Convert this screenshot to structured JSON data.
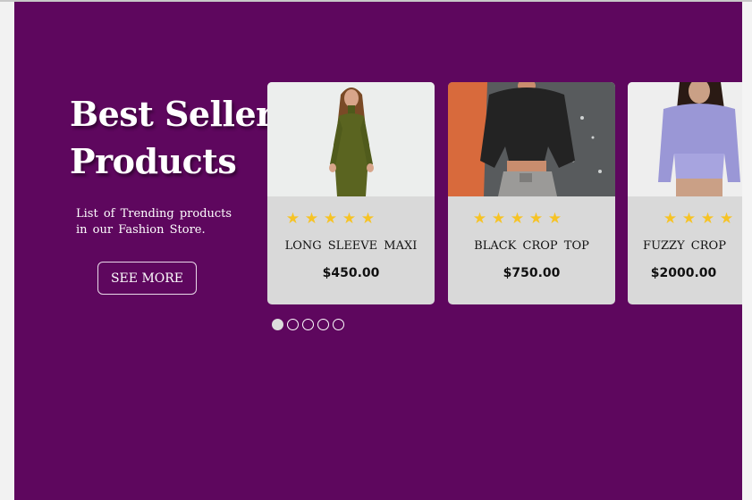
{
  "section": {
    "title_line1": "Best Seller",
    "title_line2": "Products",
    "subtitle_line1": "List of Trending products",
    "subtitle_line2": "in our Fashion Store.",
    "see_more_label": "SEE MORE"
  },
  "products": [
    {
      "name": "LONG SLEEVE MAXI",
      "price": "$450.00",
      "rating": 5,
      "star": "★"
    },
    {
      "name": "BLACK CROP TOP",
      "price": "$750.00",
      "rating": 5,
      "star": "★"
    },
    {
      "name": "FUZZY CROP",
      "price": "$2000.00",
      "rating": 4,
      "star": "★"
    }
  ],
  "carousel": {
    "slides": 5,
    "active_index": 0
  },
  "colors": {
    "background": "#5e075e",
    "card": "#d9d9d9",
    "star": "#f6c325",
    "text_light": "#ffffff"
  }
}
